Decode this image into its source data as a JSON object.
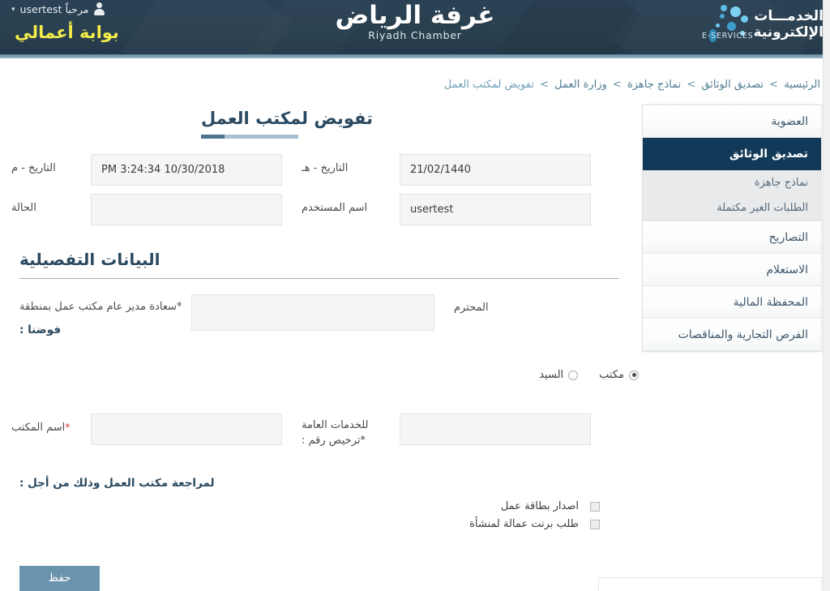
{
  "header": {
    "greeting": "مرحباً usertest",
    "caret": "▾",
    "user_icon": "user-icon",
    "portal_title": "بوابة أعمالي",
    "chamber_ar": "غرفة الرياض",
    "chamber_en": "Riyadh Chamber",
    "eservices_line1": "الخدمـــات",
    "eservices_line2": "الإلكترونية",
    "eservices_en": "E-SERVICES",
    "colors": {
      "header_bg": "#29404f",
      "accent_strip": "#7ea0b4",
      "portal_title": "#f2eb4a"
    }
  },
  "breadcrumb": {
    "items": [
      {
        "label": "الرئيسية"
      },
      {
        "label": "تصديق الوثائق"
      },
      {
        "label": "نماذج جاهزة"
      },
      {
        "label": "وزارة العمل"
      },
      {
        "label": "تفويض لمكتب العمل"
      }
    ],
    "separator": ">"
  },
  "sidebar": {
    "items": [
      {
        "label": "العضوية",
        "active": false
      },
      {
        "label": "تصديق الوثائق",
        "active": true
      },
      {
        "label": "التصاريح",
        "active": false
      },
      {
        "label": "الاستعلام",
        "active": false
      },
      {
        "label": "المحفظة المالية",
        "active": false
      },
      {
        "label": "الفرص التجارية والمناقصات",
        "active": false
      }
    ],
    "sub_items": [
      {
        "label": "نماذج جاهزة"
      },
      {
        "label": "الطلبات الغير مكتملة"
      }
    ],
    "active_color": "#123a58"
  },
  "main": {
    "page_title": "تفويض لمكتب العمل",
    "section_title": "البيانات التفصيلية",
    "fields": {
      "date_gregorian_label": "التاريخ - م",
      "date_gregorian_value": "10/30/2018 3:24:34 PM",
      "date_hijri_label": "التاريخ - هـ",
      "date_hijri_value": "21/02/1440",
      "status_label": "الحالة",
      "status_value": "",
      "username_label": "اسم المستخدم",
      "username_value": "usertest",
      "director_label": "سعادة مدير عام مكتب عمل بمنطقة",
      "director_required": "*",
      "director_value": "",
      "muhtaram_label": "المحترم",
      "fawadna_label": "فوضنا :",
      "office_name_label": "اسم المكتب",
      "office_name_required": "*",
      "office_name_value": "",
      "license_label_line1": "للخدمات العامة",
      "license_label_line2": "ترخيص رقم :",
      "license_required": "*",
      "license_value": ""
    },
    "radios": [
      {
        "label": "مكتب",
        "selected": true
      },
      {
        "label": "السيد",
        "selected": false
      }
    ],
    "purpose_title": "لمراجعة مكتب العمل وذلك من أجل :",
    "checkboxes": [
      {
        "label": "اصدار بطاقة عمل",
        "checked": false
      },
      {
        "label": "طلب برنت عمالة لمنشأة",
        "checked": false
      }
    ],
    "save_label": "حفظ"
  }
}
